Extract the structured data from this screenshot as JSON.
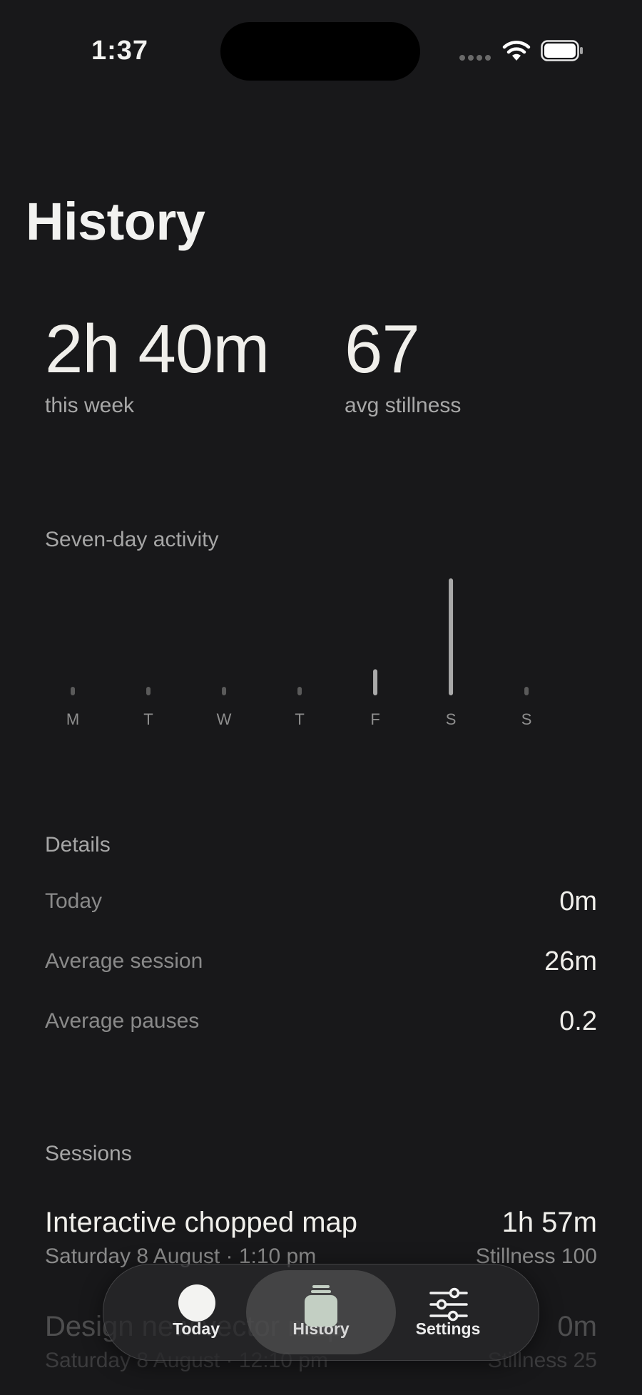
{
  "status_bar": {
    "time": "1:37"
  },
  "page": {
    "title": "History"
  },
  "stats": [
    {
      "value": "2h 40m",
      "label": "this week"
    },
    {
      "value": "67",
      "label": "avg stillness"
    }
  ],
  "chart_data": {
    "type": "bar",
    "title": "Seven-day activity",
    "categories": [
      "M",
      "T",
      "W",
      "T",
      "F",
      "S",
      "S"
    ],
    "values_minutes": [
      0,
      0,
      0,
      0,
      26,
      134,
      0
    ],
    "bar_color": "#a9a9a9"
  },
  "details": {
    "label": "Details",
    "rows": [
      {
        "key": "Today",
        "value": "0m"
      },
      {
        "key": "Average session",
        "value": "26m"
      },
      {
        "key": "Average pauses",
        "value": "0.2"
      }
    ]
  },
  "sessions": {
    "label": "Sessions",
    "items": [
      {
        "title": "Interactive chopped map",
        "date": "Saturday 8 August · 1:10 pm",
        "duration": "1h 57m",
        "stillness": "Stillness 100"
      },
      {
        "title": "Design new vector map",
        "date": "Saturday 8 August · 12:10 pm",
        "duration": "0m",
        "stillness": "Stillness 25"
      }
    ]
  },
  "tabbar": {
    "tabs": [
      {
        "label": "Today",
        "icon": "circle-icon"
      },
      {
        "label": "History",
        "icon": "jar-icon",
        "active": true
      },
      {
        "label": "Settings",
        "icon": "sliders-icon"
      }
    ],
    "active_color": "#c3cfc3"
  }
}
